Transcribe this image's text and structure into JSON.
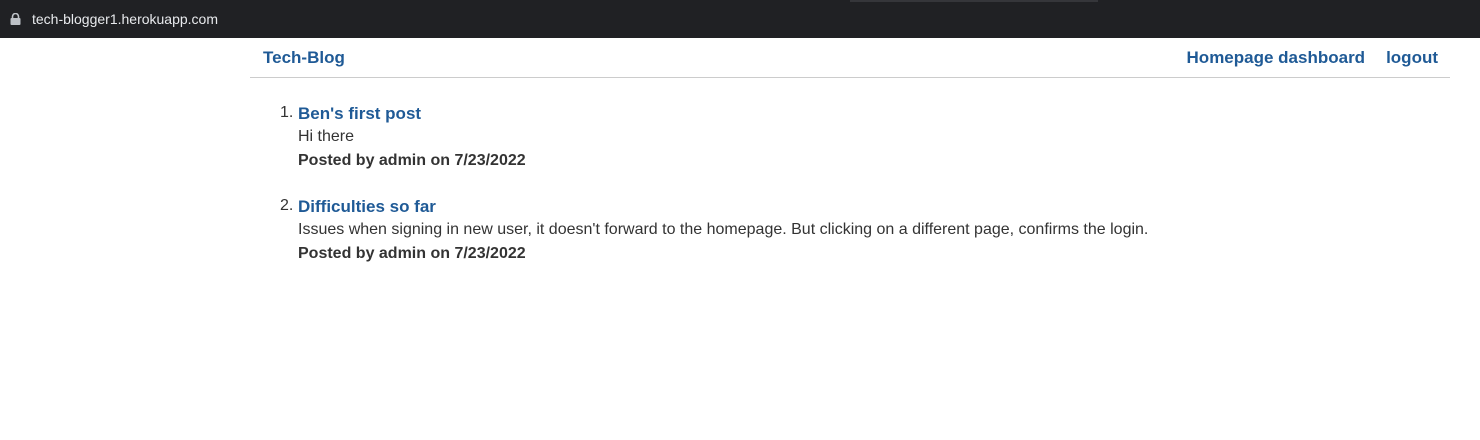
{
  "browser": {
    "url": "tech-blogger1.herokuapp.com",
    "lock_icon": "lock-icon"
  },
  "nav": {
    "brand": "Tech-Blog",
    "links": [
      {
        "label": "Homepage dashboard"
      },
      {
        "label": "logout"
      }
    ]
  },
  "posts": [
    {
      "number": "1.",
      "title": "Ben's first post",
      "body": "Hi there",
      "meta": "Posted by admin on 7/23/2022"
    },
    {
      "number": "2.",
      "title": "Difficulties so far",
      "body": "Issues when signing in new user, it doesn't forward to the homepage. But clicking on a different page, confirms the login.",
      "meta": "Posted by admin on 7/23/2022"
    }
  ],
  "colors": {
    "link": "#1f5a96",
    "text": "#333333",
    "browser_bar": "#202124"
  }
}
